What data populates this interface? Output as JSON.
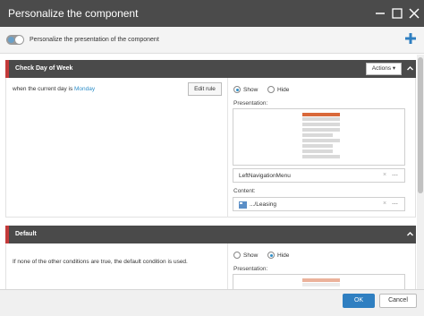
{
  "dialog": {
    "title": "Personalize the component"
  },
  "toolbar": {
    "toggle_label": "Personalize the presentation of the component"
  },
  "rules": [
    {
      "name": "Check Day of Week",
      "actions_label": "Actions",
      "condition_prefix": "when the current day is",
      "condition_value": "Monday",
      "edit_rule_label": "Edit rule",
      "show_label": "Show",
      "hide_label": "Hide",
      "selected": "Show",
      "presentation_label": "Presentation:",
      "preview_heading": "COMMERCIAL PACKAGE",
      "rendering_value": "LeftNavigationMenu",
      "content_label": "Content:",
      "content_value": ".../Leasing"
    },
    {
      "name": "Default",
      "condition_text": "If none of the other conditions are true, the default condition is used.",
      "show_label": "Show",
      "hide_label": "Hide",
      "selected": "Hide",
      "presentation_label": "Presentation:",
      "preview_heading": "COMMERCIAL PACKAGE"
    }
  ],
  "footer": {
    "ok_label": "OK",
    "cancel_label": "Cancel"
  },
  "colors": {
    "titlebar": "#4b4b4b",
    "accent": "#2f7fc1",
    "rule_marker": "#c33a3a",
    "link": "#2f8fc9"
  }
}
